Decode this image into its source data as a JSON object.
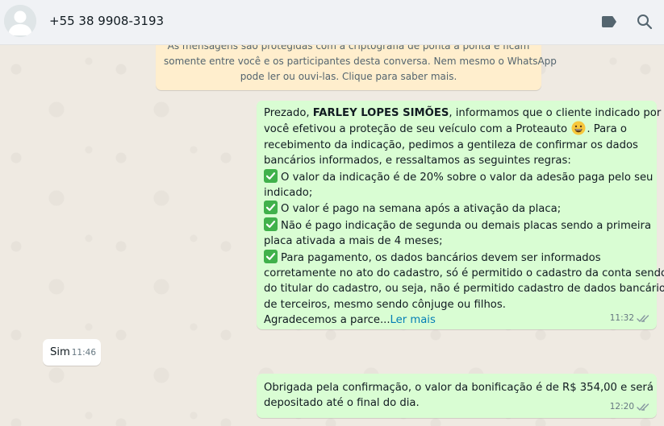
{
  "header": {
    "contact_name": "+55 38 9908-3193",
    "icons": [
      "label-icon",
      "search-icon"
    ]
  },
  "notice": {
    "text": "🔒 As mensagens são protegidas com a criptografia de ponta a ponta e ficam somente entre você e os participantes desta conversa. Nem mesmo o WhatsApp pode ler ou ouvi-las. Clique para saber mais.",
    "line1": "As mensagens são protegidas com a criptografia de ponta a ponta e ficam",
    "line2": "somente entre você e os participantes desta conversa. Nem mesmo o WhatsApp",
    "line3": "pode ler ou ouvi-las. Clique para saber mais."
  },
  "messages": [
    {
      "direction": "outgoing",
      "lines": {
        "l1_pre": "Prezado, ",
        "l1_bold": "FARLEY LOPES SIMÕES",
        "l1_post": ", informamos que o cliente indicado por",
        "l2": "você efetivou a proteção de seu veículo com a Proteauto",
        "l2_post": ". Para o",
        "l3": "recebimento da indicação, pedimos a gentileza de confirmar os dados",
        "l4": "bancários informados, e  ressaltamos as seguintes regras:",
        "l5": "O valor da indicação é de 20% sobre o valor da adesão paga pelo seu",
        "l6": "indicado;",
        "l7": "O valor é pago na semana após a ativação da placa;",
        "l8": "Não é pago indicação de segunda ou demais placas sendo a primeira",
        "l9": "placa ativada a mais de 4 meses;",
        "l10": "Para pagamento, os dados bancários devem ser informados",
        "l11": "corretamente no ato do cadastro, só é permitido o cadastro da conta sendo",
        "l12": "do titular do cadastro, ou seja, não é permitido cadastro de dados bancários",
        "l13": "de terceiros, mesmo sendo cônjuge ou filhos.",
        "l14": "Agradecemos a parce...",
        "read_more": "Ler mais"
      },
      "time": "11:32",
      "status": "double-check-icon"
    },
    {
      "direction": "incoming",
      "text": "Sim",
      "time": "11:46"
    },
    {
      "direction": "outgoing",
      "line1": "Obrigada pela confirmação, o valor da bonificação é de R$ 354,00 e será",
      "line2": "depositado até o final do dia.",
      "time": "12:20",
      "status": "double-check-icon"
    }
  ],
  "colors": {
    "header_bg": "#f0f2f5",
    "chat_bg": "#efeae2",
    "outgoing_bubble": "#d9fdd3",
    "incoming_bubble": "#ffffff",
    "notice_bg": "#ffeecd",
    "link": "#027eb5",
    "check_emoji": "#40b14b"
  }
}
